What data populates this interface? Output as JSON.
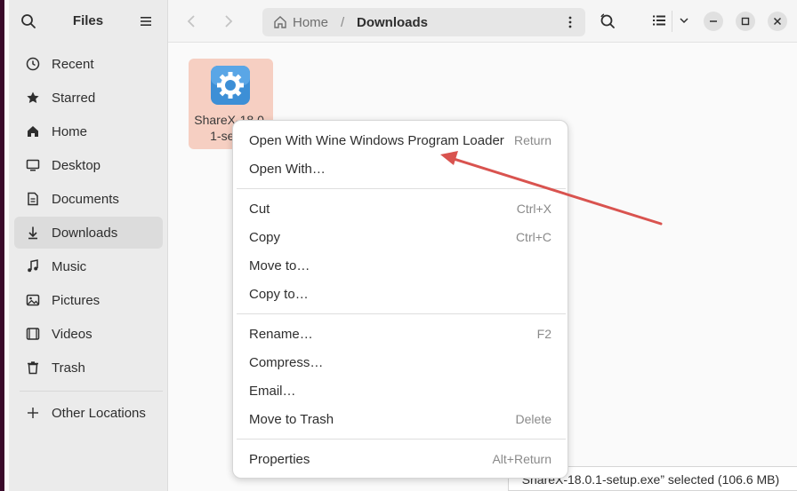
{
  "sidebar": {
    "title": "Files",
    "items": [
      {
        "label": "Recent",
        "icon": "clock-icon"
      },
      {
        "label": "Starred",
        "icon": "star-icon"
      },
      {
        "label": "Home",
        "icon": "home-icon"
      },
      {
        "label": "Desktop",
        "icon": "desktop-icon"
      },
      {
        "label": "Documents",
        "icon": "document-icon"
      },
      {
        "label": "Downloads",
        "icon": "download-icon"
      },
      {
        "label": "Music",
        "icon": "music-icon"
      },
      {
        "label": "Pictures",
        "icon": "picture-icon"
      },
      {
        "label": "Videos",
        "icon": "video-icon"
      },
      {
        "label": "Trash",
        "icon": "trash-icon"
      }
    ],
    "other_locations": "Other Locations"
  },
  "header": {
    "path_home": "Home",
    "path_separator": "/",
    "path_current": "Downloads"
  },
  "file": {
    "name_line1": "ShareX-18.0.",
    "name_line2": "1-setup"
  },
  "context_menu": {
    "open_with_wine": "Open With Wine Windows Program Loader",
    "open_with_wine_accel": "Return",
    "open_with": "Open With…",
    "cut": "Cut",
    "cut_accel": "Ctrl+X",
    "copy": "Copy",
    "copy_accel": "Ctrl+C",
    "move_to": "Move to…",
    "copy_to": "Copy to…",
    "rename": "Rename…",
    "rename_accel": "F2",
    "compress": "Compress…",
    "email": "Email…",
    "move_to_trash": "Move to Trash",
    "move_to_trash_accel": "Delete",
    "properties": "Properties",
    "properties_accel": "Alt+Return"
  },
  "status": "“ShareX-18.0.1-setup.exe” selected  (106.6 MB)",
  "colors": {
    "selection": "#f6cfc2",
    "annotation_arrow": "#d9534f",
    "app_icon": "#3d8fd6"
  }
}
